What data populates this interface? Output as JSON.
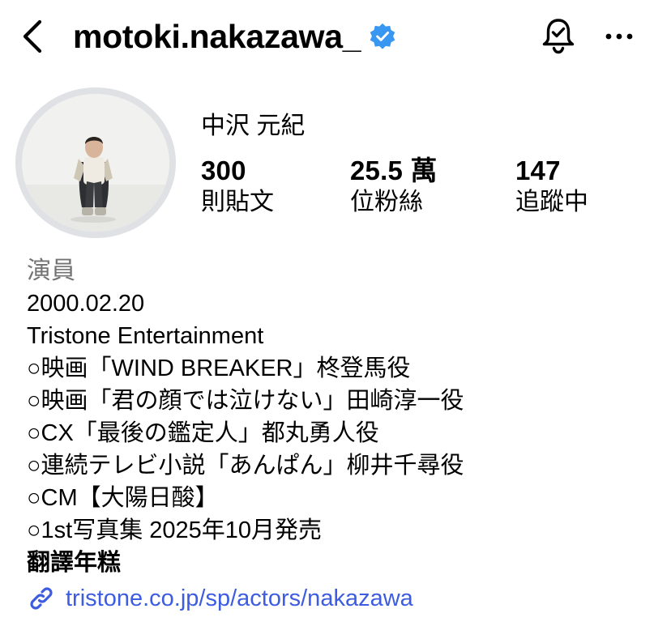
{
  "header": {
    "username": "motoki.nakazawa_",
    "icons": {
      "back": "chevron-left-icon",
      "verified": "verified-badge-icon",
      "notifications": "bell-check-icon",
      "more": "more-horizontal-icon"
    }
  },
  "profile": {
    "display_name": "中沢 元紀",
    "stats": [
      {
        "value": "300",
        "label": "則貼文"
      },
      {
        "value": "25.5 萬",
        "label": "位粉絲"
      },
      {
        "value": "147",
        "label": "追蹤中"
      }
    ]
  },
  "bio": {
    "category": "演員",
    "lines": [
      "2000.02.20",
      "Tristone Entertainment",
      "○映画「WIND BREAKER」柊登馬役",
      "○映画「君の顔では泣けない」田崎淳一役",
      "○CX「最後の鑑定人」都丸勇人役",
      "○連続テレビ小説「あんぱん」柳井千尋役",
      "○CM【大陽日酸】",
      "○1st写真集 2025年10月発売"
    ],
    "translate_label": "翻譯年糕",
    "link": "tristone.co.jp/sp/actors/nakazawa"
  },
  "colors": {
    "verified": "#3897f0",
    "link": "#3d5ce0",
    "category": "#737373",
    "avatar_ring": "#dfe1e5"
  }
}
